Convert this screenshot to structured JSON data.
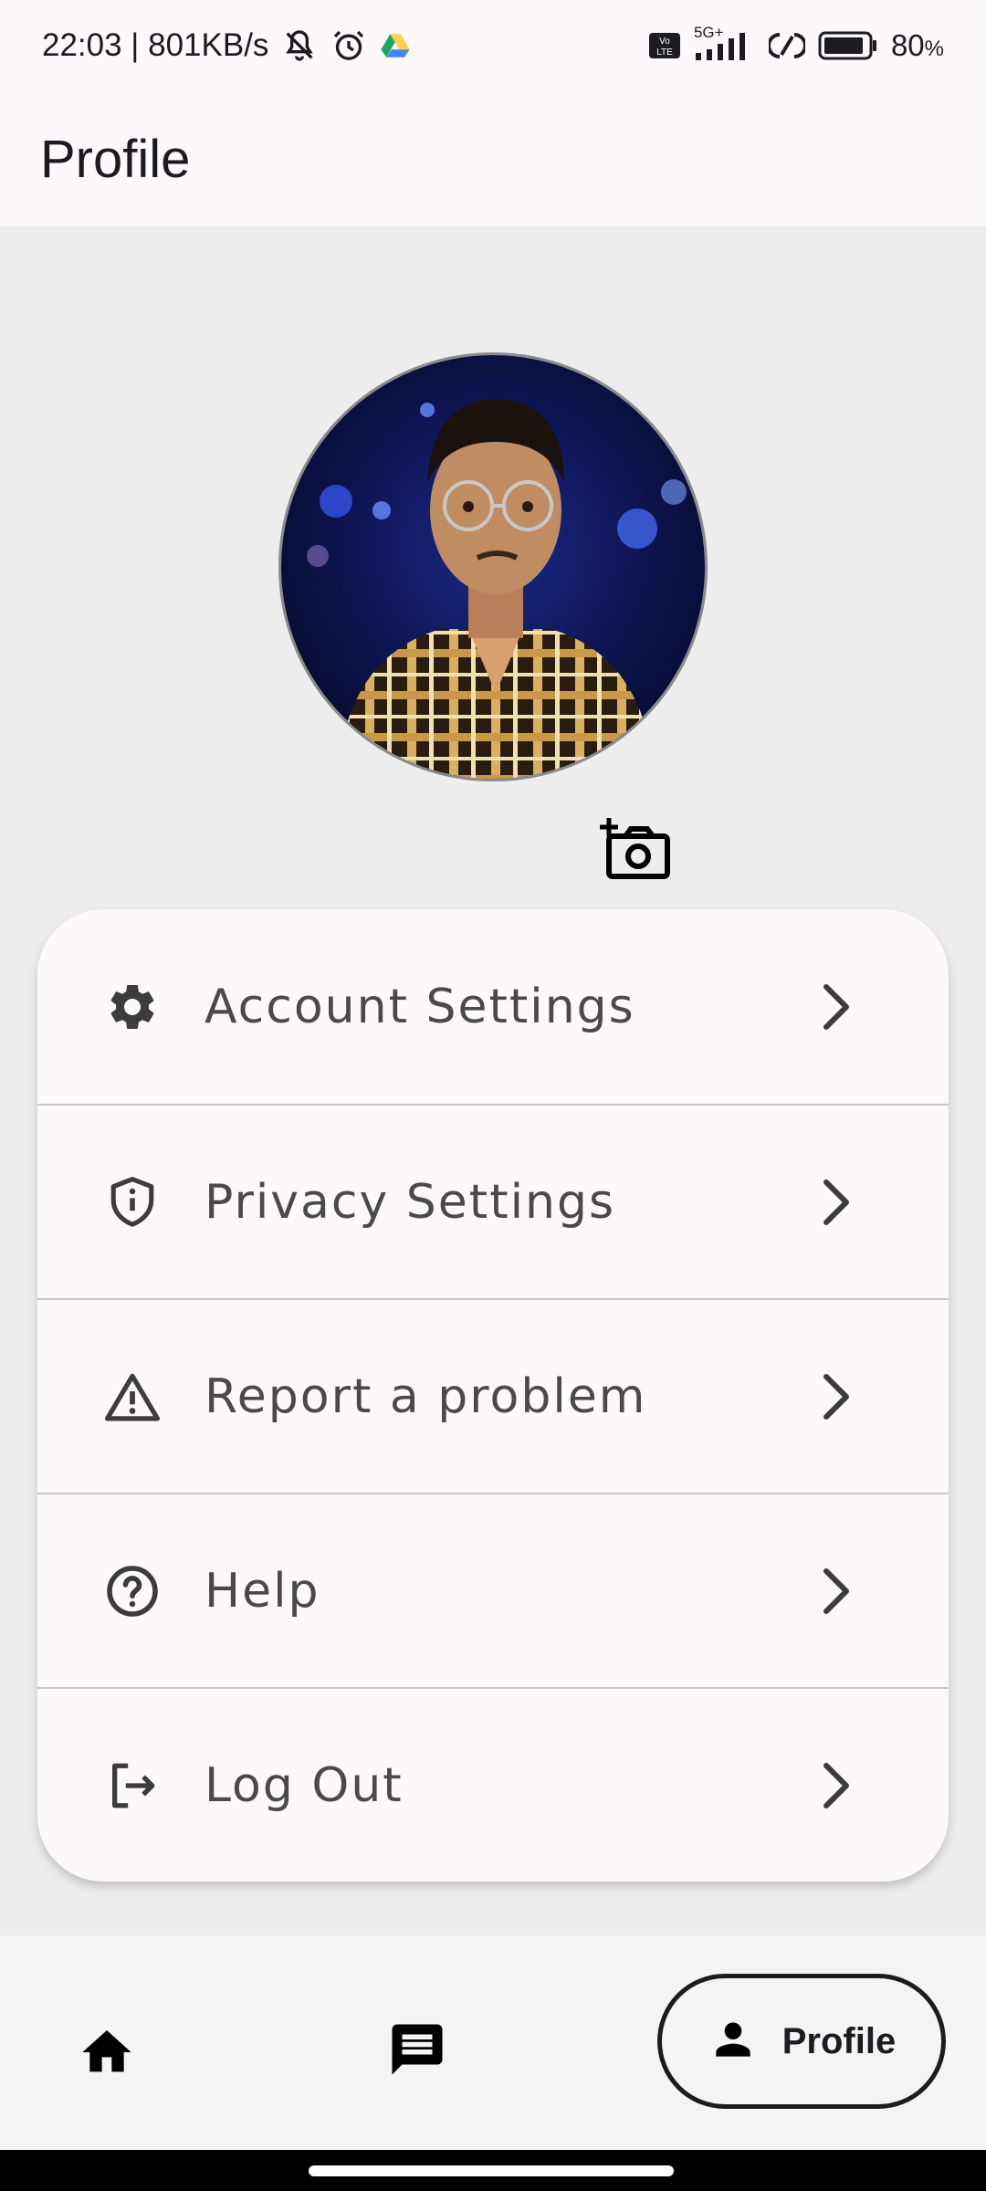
{
  "status_bar": {
    "time_speed": "22:03 | 801KB/s",
    "network": "5G+",
    "battery": "80",
    "battery_unit": "%",
    "icons": [
      "mute-icon",
      "alarm-icon",
      "drive-icon",
      "volte-icon",
      "signal-icon",
      "hotspot-icon",
      "battery-icon"
    ]
  },
  "app_bar": {
    "title": "Profile"
  },
  "profile": {
    "avatar": "profile-photo",
    "camera_icon": "add-photo-icon"
  },
  "menu": {
    "items": [
      {
        "label": "Account Settings",
        "icon": "gear-icon"
      },
      {
        "label": "Privacy Settings",
        "icon": "shield-info-icon"
      },
      {
        "label": "Report a problem",
        "icon": "warning-icon"
      },
      {
        "label": "Help",
        "icon": "help-circle-icon"
      },
      {
        "label": "Log Out",
        "icon": "logout-icon"
      }
    ],
    "chevron_icon": "chevron-right-icon"
  },
  "bottom_nav": {
    "home_icon": "home-icon",
    "messages_icon": "chat-icon",
    "profile_icon": "person-icon",
    "profile_label": "Profile",
    "selected": "Profile"
  },
  "colors": {
    "surface": "#fdf8fb",
    "background": "#ededed",
    "text": "#1c1b1f",
    "menu_text": "#4a4a4a",
    "divider": "#c9c6c9",
    "nav_bar": "#f4f4f4"
  }
}
